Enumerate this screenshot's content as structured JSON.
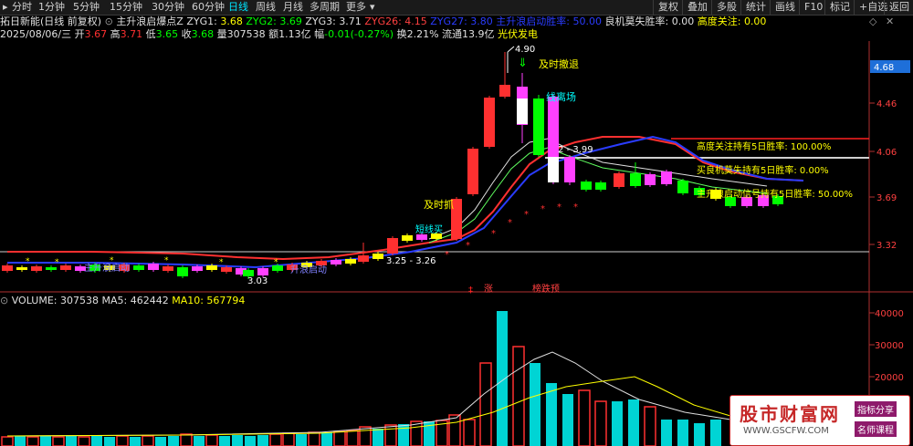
{
  "toolbar": {
    "timeframes": [
      "分时",
      "1分钟",
      "5分钟",
      "15分钟",
      "30分钟",
      "60分钟",
      "日线",
      "周线",
      "月线",
      "多周期",
      "更多"
    ],
    "active_timeframe": "日线",
    "right_buttons": [
      "复权",
      "叠加",
      "多股",
      "统计",
      "画线",
      "F10",
      "标记",
      "+自选",
      "返回"
    ]
  },
  "header": {
    "stock_name": "拓日新能(日线 前复权)",
    "formula_name": "主升浪启爆点Z",
    "zyg1_label": "ZYG1:",
    "zyg1_value": "3.68",
    "zyg2_label": "ZYG2:",
    "zyg2_value": "3.69",
    "zyg3_label": "ZYG3:",
    "zyg3_value": "3.71",
    "zyg26_label": "ZYG26:",
    "zyg26_value": "4.15",
    "zyg27_label": "ZYG27:",
    "zyg27_value": "3.80",
    "main_win_label": "主升浪启动胜率:",
    "main_win_value": "50.00",
    "liangji_label": "良机莫失胜率:",
    "liangji_value": "0.00",
    "gaodu_label": "高度关注:",
    "gaodu_value": "0.00"
  },
  "quote": {
    "date": "2025/08/06/三",
    "open_label": "开",
    "open": "3.67",
    "high_label": "高",
    "high": "3.71",
    "low_label": "低",
    "low": "3.65",
    "close_label": "收",
    "close": "3.68",
    "volume_label": "量",
    "volume": "307538",
    "amount_label": "额",
    "amount": "1.13亿",
    "change_label": "幅",
    "change": "-0.01(-0.27%)",
    "turnover_label": "换",
    "turnover": "2.21%",
    "float_label": "流通",
    "float": "13.9亿",
    "sector": "光伏发电"
  },
  "price_axis": {
    "ticks": [
      "4.46",
      "4.06",
      "3.69",
      "3.32"
    ],
    "current": "4.68"
  },
  "chart_annotations": {
    "peak": "4.90",
    "retreat": "及时撤退",
    "lianglu": "线离场",
    "buy": "及时抓",
    "short_line": "短线买",
    "range_label": "2 - 3.99",
    "low_range": "3.25 - 3.26",
    "bottom_price": "3.03",
    "main_start_1": "主升浪启动",
    "main_start_2": "升浪启动",
    "limit_up": "涨",
    "limit_down": "榜跌预",
    "gaodu_stat": "高度关注持有5日胜率:  100.00%",
    "liangji_stat": "买良机莫失持有5日胜率:  0.00%",
    "main_stat": "主升浪启动信号持有5日胜率:  50.00%"
  },
  "volume_panel": {
    "label": "VOLUME: 307538",
    "ma5": "MA5: 462442",
    "ma10": "MA10: 567794",
    "ticks": [
      "40000",
      "30000",
      "20000"
    ]
  },
  "watermark": {
    "title": "股市财富网",
    "url": "WWW.GSCFW.COM",
    "tag1": "指标分享",
    "tag2": "名师课程"
  },
  "colors": {
    "up": "#ff3030",
    "down": "#00d4d4",
    "ma_blue": "#2a3cff",
    "ma_red": "#ff2020",
    "yellow": "#ffff00",
    "magenta": "#ff40ff",
    "green": "#00ff00",
    "cyan": "#00ffff"
  }
}
